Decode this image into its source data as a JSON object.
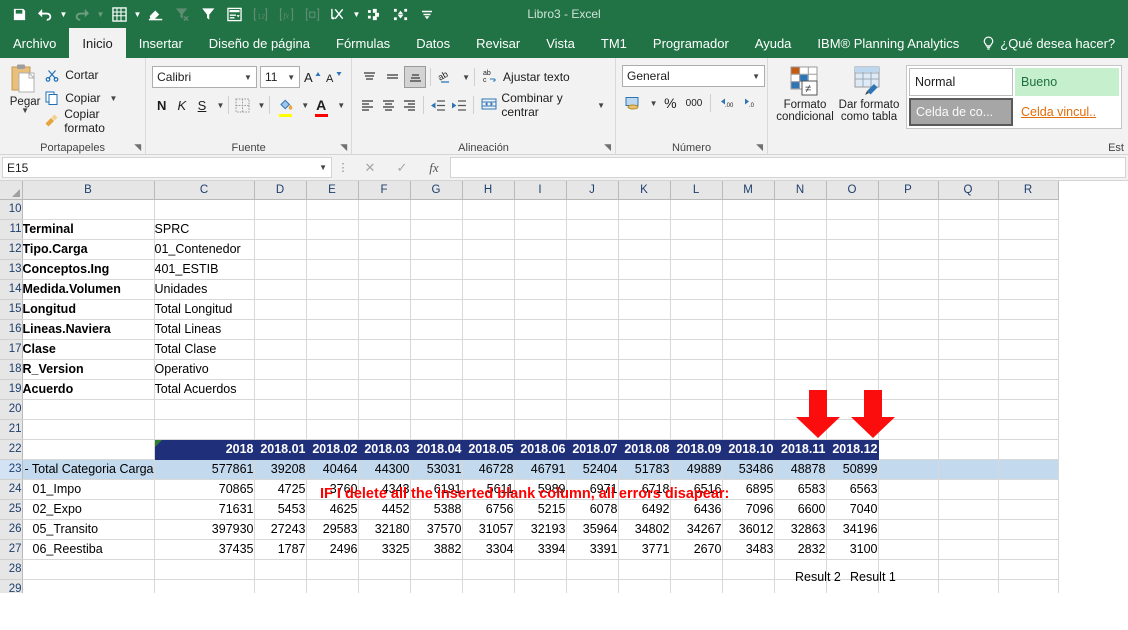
{
  "titlebar": {
    "app_title": "Libro3  -  Excel",
    "qat": [
      {
        "name": "save-icon",
        "label": "Guardar",
        "enabled": true
      },
      {
        "name": "undo-icon",
        "label": "Deshacer",
        "enabled": true,
        "caret": true
      },
      {
        "name": "redo-icon",
        "label": "Rehacer",
        "enabled": false,
        "caret": true
      },
      {
        "name": "recalculate-icon",
        "label": "Recalcular",
        "enabled": true,
        "caret": true
      },
      {
        "name": "eraser-icon",
        "label": "Borrar",
        "enabled": true
      },
      {
        "name": "clear-filter-icon",
        "label": "Borrar filtro",
        "enabled": false
      },
      {
        "name": "filter-icon",
        "label": "Filtro",
        "enabled": true
      },
      {
        "name": "subset-editor-icon",
        "label": "Editor de subconjuntos",
        "enabled": true
      },
      {
        "name": "format-number-icon",
        "label": "Formato numero",
        "enabled": false
      },
      {
        "name": "function-icon",
        "label": "Funcion",
        "enabled": false
      },
      {
        "name": "copy-cube-icon",
        "label": "Copiar",
        "enabled": false
      },
      {
        "name": "sandbox-icon",
        "label": "Sandbox",
        "enabled": true,
        "caret": true
      },
      {
        "name": "drill-icon",
        "label": "Drill",
        "enabled": true
      },
      {
        "name": "expand-icon",
        "label": "Expandir",
        "enabled": true
      },
      {
        "name": "customize-qat-icon",
        "label": "Personalizar barra de herramientas",
        "enabled": true
      }
    ]
  },
  "ribbon_tabs": [
    {
      "label": "Archivo",
      "active": false
    },
    {
      "label": "Inicio",
      "active": true
    },
    {
      "label": "Insertar",
      "active": false
    },
    {
      "label": "Diseño de página",
      "active": false
    },
    {
      "label": "Fórmulas",
      "active": false
    },
    {
      "label": "Datos",
      "active": false
    },
    {
      "label": "Revisar",
      "active": false
    },
    {
      "label": "Vista",
      "active": false
    },
    {
      "label": "TM1",
      "active": false
    },
    {
      "label": "Programador",
      "active": false
    },
    {
      "label": "Ayuda",
      "active": false
    },
    {
      "label": "IBM® Planning Analytics",
      "active": false
    }
  ],
  "tell_me": "¿Qué desea hacer?",
  "ribbon": {
    "clipboard": {
      "group_label": "Portapapeles",
      "paste_label": "Pegar",
      "cut_label": "Cortar",
      "copy_label": "Copiar",
      "format_painter_label": "Copiar formato"
    },
    "font": {
      "group_label": "Fuente",
      "font_name": "Calibri",
      "font_size": "11",
      "bold_label": "N",
      "italic_label": "K",
      "underline_label": "S"
    },
    "alignment": {
      "group_label": "Alineación",
      "wrap_text_label": "Ajustar texto",
      "merge_center_label": "Combinar y centrar"
    },
    "number": {
      "group_label": "Número",
      "format": "General",
      "percent_label": "%",
      "thousands_label": "000"
    },
    "styles": {
      "group_label": "Est",
      "conditional_format_label": "Formato condicional",
      "format_as_table_label": "Dar formato como tabla",
      "cells": [
        {
          "label": "Normal",
          "style": "s-normal"
        },
        {
          "label": "Bueno",
          "style": "s-bueno"
        },
        {
          "label": "Celda de co...",
          "style": "s-calc"
        },
        {
          "label": "Celda vincul..",
          "style": "s-vinc"
        }
      ]
    }
  },
  "formula_bar": {
    "name_box": "E15",
    "formula": "",
    "cancel_label": "✕",
    "accept_label": "✓",
    "fx_label": "fx"
  },
  "grid": {
    "columns": [
      "B",
      "C",
      "D",
      "E",
      "F",
      "G",
      "H",
      "I",
      "J",
      "K",
      "L",
      "M",
      "N",
      "O",
      "P",
      "Q",
      "R"
    ],
    "rows": [
      "10",
      "11",
      "12",
      "13",
      "14",
      "15",
      "16",
      "17",
      "18",
      "19",
      "20",
      "21",
      "22",
      "23",
      "24",
      "25",
      "26",
      "27",
      "28",
      "29"
    ],
    "selected_row": "23",
    "params": [
      {
        "row": "11",
        "label": "Terminal",
        "value": "SPRC"
      },
      {
        "row": "12",
        "label": "Tipo.Carga",
        "value": "01_Contenedor"
      },
      {
        "row": "13",
        "label": "Conceptos.Ing",
        "value": "401_ESTIB"
      },
      {
        "row": "14",
        "label": "Medida.Volumen",
        "value": "Unidades"
      },
      {
        "row": "15",
        "label": "Longitud",
        "value": "Total Longitud"
      },
      {
        "row": "16",
        "label": "Lineas.Naviera",
        "value": "Total Lineas"
      },
      {
        "row": "17",
        "label": "Clase",
        "value": "Total Clase"
      },
      {
        "row": "18",
        "label": "R_Version",
        "value": "Operativo"
      },
      {
        "row": "19",
        "label": "Acuerdo",
        "value": "Total Acuerdos"
      }
    ],
    "annotation": "IF I delete all the inserted blank column, all errors disapear:",
    "annotation_color": "#ff0000",
    "result_labels": [
      {
        "column": "N",
        "label": "Result 2"
      },
      {
        "column": "O",
        "label": "Result 1"
      }
    ],
    "arrow_color": "#fc0d0d",
    "table": {
      "header_row": "22",
      "headers": [
        "2018",
        "2018.01",
        "2018.02",
        "2018.03",
        "2018.04",
        "2018.05",
        "2018.06",
        "2018.07",
        "2018.08",
        "2018.09",
        "2018.10",
        "2018.11",
        "2018.12"
      ],
      "rows": [
        {
          "row": "23",
          "label": "- Total Categoria Carga",
          "total": true,
          "values": [
            "577861",
            "39208",
            "40464",
            "44300",
            "53031",
            "46728",
            "46791",
            "52404",
            "51783",
            "49889",
            "53486",
            "48878",
            "50899"
          ]
        },
        {
          "row": "24",
          "label": "01_Impo",
          "total": false,
          "values": [
            "70865",
            "4725",
            "3760",
            "4343",
            "6191",
            "5611",
            "5989",
            "6971",
            "6718",
            "6516",
            "6895",
            "6583",
            "6563"
          ]
        },
        {
          "row": "25",
          "label": "02_Expo",
          "total": false,
          "values": [
            "71631",
            "5453",
            "4625",
            "4452",
            "5388",
            "6756",
            "5215",
            "6078",
            "6492",
            "6436",
            "7096",
            "6600",
            "7040"
          ]
        },
        {
          "row": "26",
          "label": "05_Transito",
          "total": false,
          "values": [
            "397930",
            "27243",
            "29583",
            "32180",
            "37570",
            "31057",
            "32193",
            "35964",
            "34802",
            "34267",
            "36012",
            "32863",
            "34196"
          ]
        },
        {
          "row": "27",
          "label": "06_Reestiba",
          "total": false,
          "values": [
            "37435",
            "1787",
            "2496",
            "3325",
            "3882",
            "3304",
            "3394",
            "3391",
            "3771",
            "2670",
            "3483",
            "2832",
            "3100"
          ]
        }
      ]
    }
  }
}
